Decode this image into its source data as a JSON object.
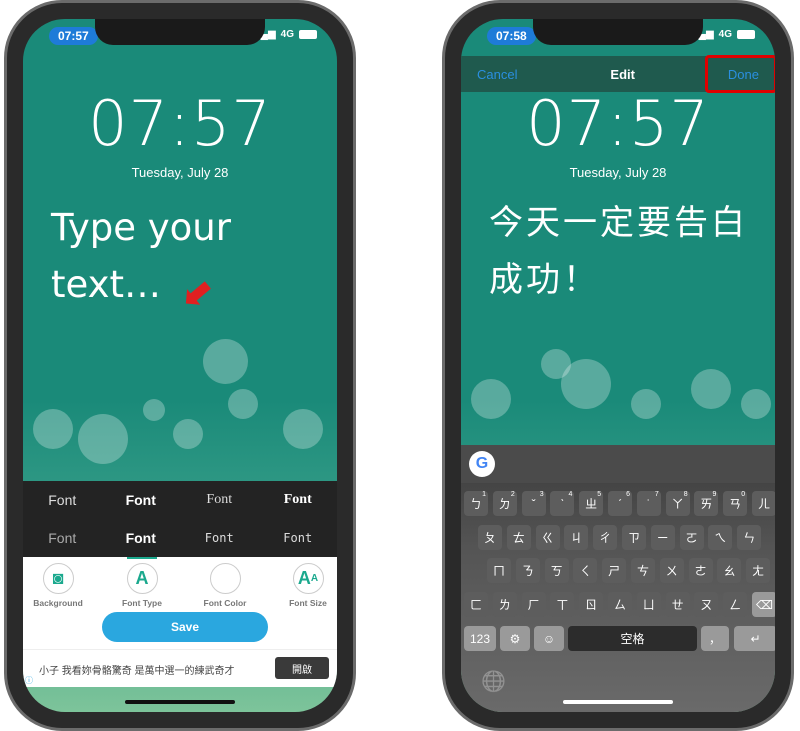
{
  "left": {
    "status": {
      "time": "07:57",
      "network": "4G"
    },
    "clock": "07:57",
    "date": "Tuesday, July 28",
    "placeholder_line1": "Type your",
    "placeholder_line2": "text…",
    "fonts": [
      "Font",
      "Font",
      "Font",
      "Font",
      "Font",
      "Font",
      "Font",
      "Font"
    ],
    "tools": [
      {
        "label": "Background",
        "icon": "camera-icon"
      },
      {
        "label": "Font Type",
        "icon": "font-a-icon"
      },
      {
        "label": "Font Color",
        "icon": "color-circle-icon"
      },
      {
        "label": "Font Size",
        "icon": "font-size-icon"
      }
    ],
    "save_label": "Save",
    "ad_text": "小子 我看妳骨骼驚奇 是萬中選一的練武奇才",
    "ad_button": "開啟",
    "accent": "#2aa7df",
    "annotation_color": "#e02020"
  },
  "right": {
    "status": {
      "time": "07:58",
      "network": "4G"
    },
    "nav": {
      "cancel": "Cancel",
      "title": "Edit",
      "done": "Done"
    },
    "clock": "07:57",
    "date": "Tuesday, July 28",
    "text_line1": "今天一定要告白",
    "text_line2": "成功！",
    "keyboard": {
      "row1": [
        [
          "ㄅ",
          "1"
        ],
        [
          "ㄉ",
          "2"
        ],
        [
          "ˇ",
          "3"
        ],
        [
          "ˋ",
          "4"
        ],
        [
          "ㄓ",
          "5"
        ],
        [
          "ˊ",
          "6"
        ],
        [
          "˙",
          "7"
        ],
        [
          "ㄚ",
          "8"
        ],
        [
          "ㄞ",
          "9"
        ],
        [
          "ㄢ",
          "0"
        ],
        [
          "ㄦ",
          ""
        ]
      ],
      "row2": [
        "ㄆ",
        "ㄊ",
        "ㄍ",
        "ㄐ",
        "ㄔ",
        "ㄗ",
        "ㄧ",
        "ㄛ",
        "ㄟ",
        "ㄣ"
      ],
      "row3": [
        "ㄇ",
        "ㄋ",
        "ㄎ",
        "ㄑ",
        "ㄕ",
        "ㄘ",
        "ㄨ",
        "ㄜ",
        "ㄠ",
        "ㄤ"
      ],
      "row4": [
        "ㄈ",
        "ㄌ",
        "ㄏ",
        "ㄒ",
        "ㄖ",
        "ㄙ",
        "ㄩ",
        "ㄝ",
        "ㄡ",
        "ㄥ"
      ],
      "numbers": "123",
      "space": "空格",
      "comma": "，",
      "return": "↵",
      "delete": "⌫",
      "emoji": "☺",
      "settings": "⚙",
      "globe": "🌐",
      "google": "G"
    },
    "highlight_color": "#e00000"
  }
}
